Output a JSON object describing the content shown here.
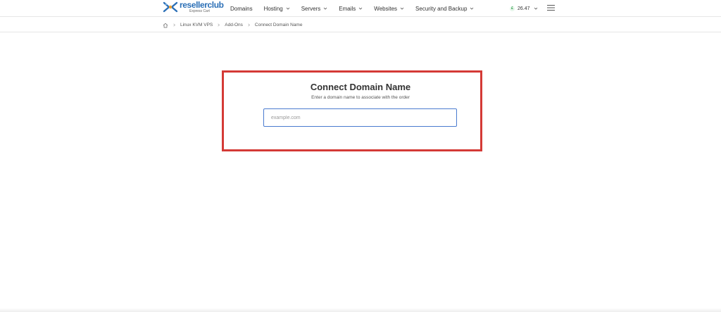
{
  "brand": {
    "name": "resellerclub",
    "tagline": "Express Cart",
    "primary_color": "#2b6fb6"
  },
  "nav": {
    "items": [
      {
        "label": "Domains",
        "has_dropdown": false
      },
      {
        "label": "Hosting",
        "has_dropdown": true
      },
      {
        "label": "Servers",
        "has_dropdown": true
      },
      {
        "label": "Emails",
        "has_dropdown": true
      },
      {
        "label": "Websites",
        "has_dropdown": true
      },
      {
        "label": "Security and Backup",
        "has_dropdown": true
      }
    ]
  },
  "account": {
    "currency_symbol": "£",
    "balance": "26.47",
    "menu_icon": "hamburger-icon"
  },
  "breadcrumb": {
    "home_icon": "home-icon",
    "items": [
      "Linux KVM VPS",
      "Add-Ons",
      "Connect Domain Name"
    ]
  },
  "form": {
    "title": "Connect Domain Name",
    "subtitle": "Enter a domain name to associate with the order",
    "input_placeholder": "example.com",
    "input_value": ""
  },
  "colors": {
    "highlight_border": "#d43a36",
    "input_border": "#4a7bd0"
  }
}
